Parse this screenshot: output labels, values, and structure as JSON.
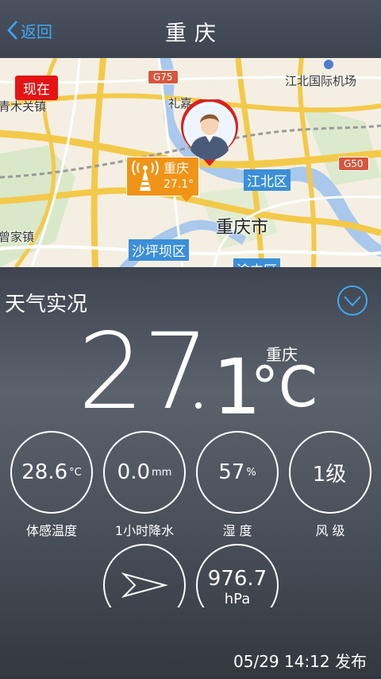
{
  "header": {
    "back_label": "返回",
    "title": "重庆"
  },
  "map": {
    "now_tag": "现在",
    "labels": {
      "qingmuguan": "青木关镇",
      "zengjia": "曾家镇",
      "lijia": "礼嘉",
      "airport": "江北国际机场",
      "city": "重庆市"
    },
    "districts": {
      "jiangbei": "江北区",
      "shapingba": "沙坪坝区",
      "yuzhong": "渝中区"
    },
    "shields": {
      "g75": "G75",
      "g50": "G50"
    },
    "station": {
      "name": "重庆",
      "temp": "27.1°"
    }
  },
  "weather": {
    "section_title": "天气实况",
    "temp_integer": "27",
    "temp_decimal": "1",
    "temp_unit": "°C",
    "city": "重庆",
    "stats": [
      {
        "value": "28.6",
        "unit": "°C",
        "label": "体感温度"
      },
      {
        "value": "0.0",
        "unit": "mm",
        "label": "1小时降水"
      },
      {
        "value": "57",
        "unit": "%",
        "label": "湿 度"
      },
      {
        "value": "1级",
        "unit": "",
        "label": "风 级"
      }
    ],
    "pressure": {
      "value": "976.7",
      "unit": "hPa"
    },
    "publish_time": "05/29 14:12 发布"
  },
  "colors": {
    "accent": "#3fa9f5",
    "now_tag": "#e41414",
    "station": "#f09418",
    "district": "#3b8fd8"
  }
}
